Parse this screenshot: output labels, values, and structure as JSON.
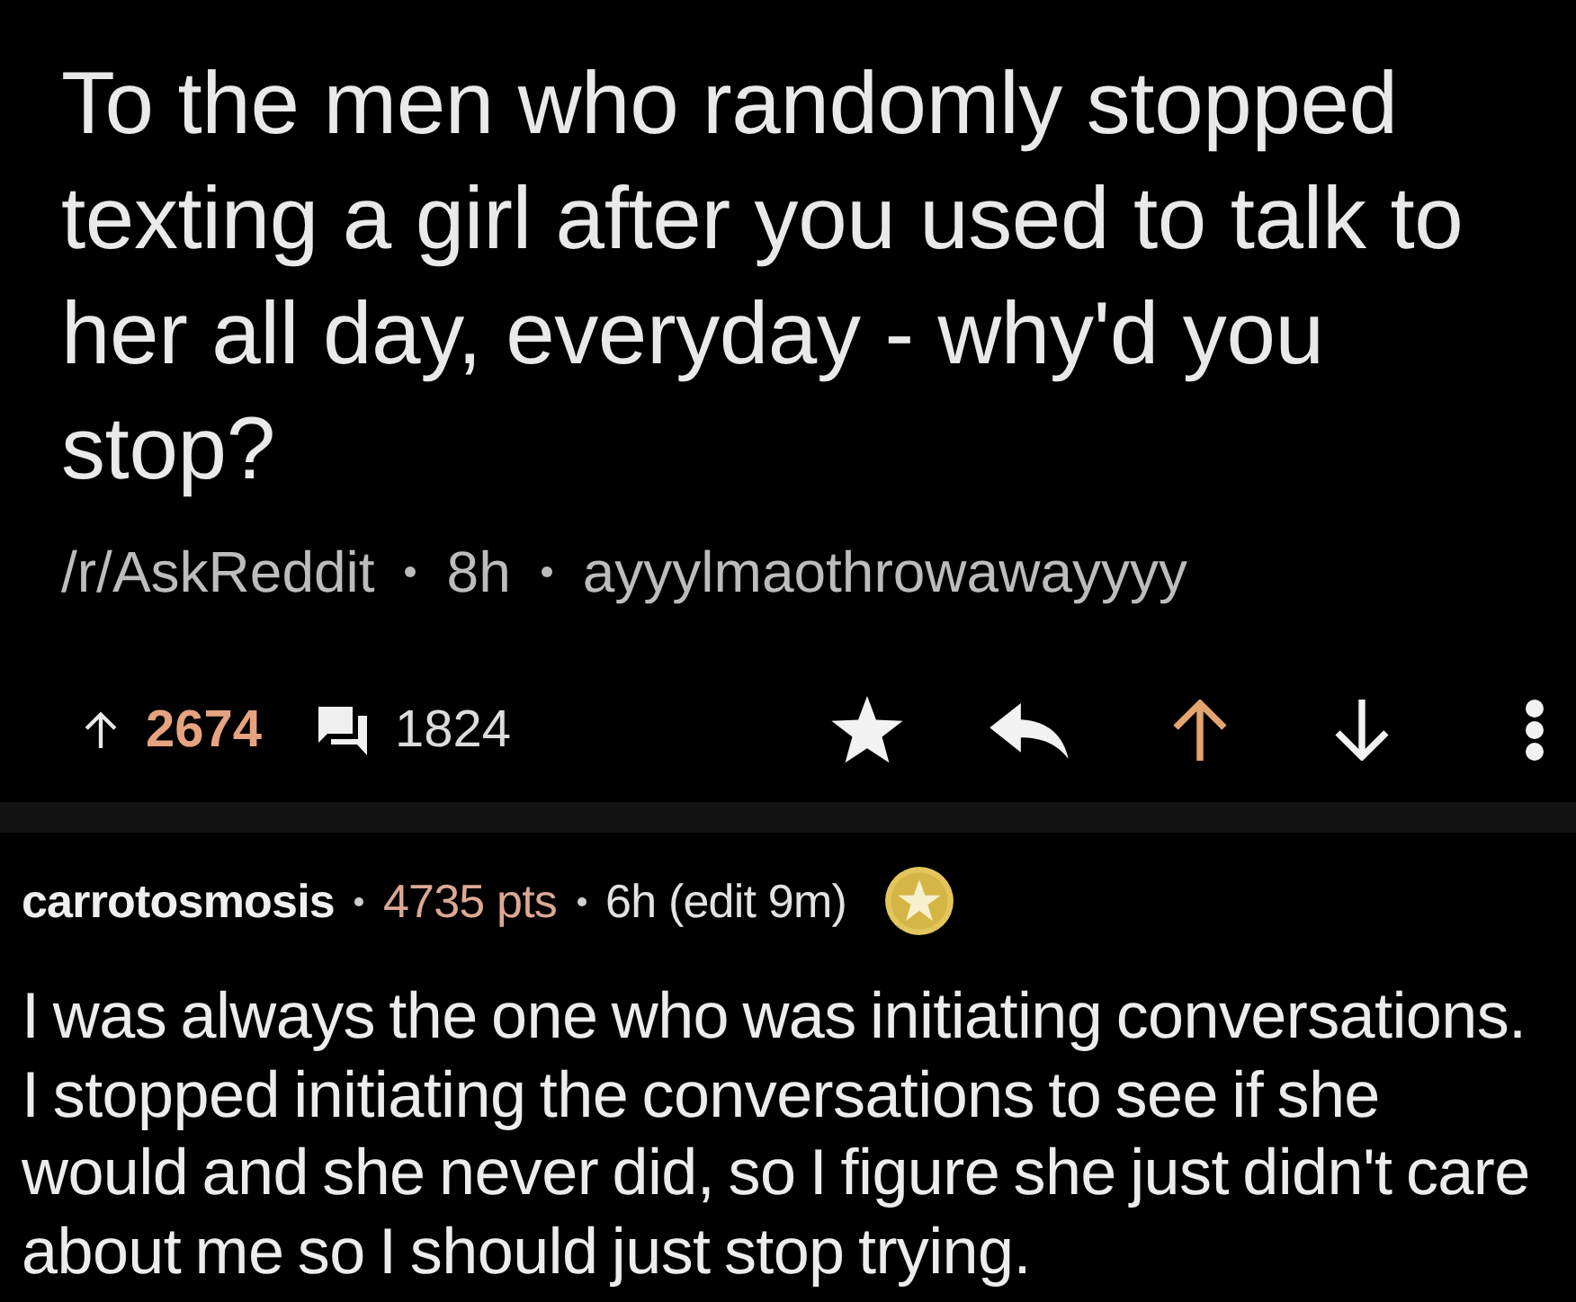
{
  "post": {
    "title": "To the men who randomly stopped texting a girl after you used to talk to her all day, everyday - why'd you stop?",
    "subreddit": "/r/AskReddit",
    "age": "8h",
    "author": "ayyylmaothrowawayyyy",
    "score": "2674",
    "comments": "1824",
    "upvoted": true,
    "downvoted": false
  },
  "comment": {
    "author": "carrotosmosis",
    "points": "4735 pts",
    "age": "6h (edit 9m)",
    "gilded": true,
    "body": "I was always the one who was initiating conversations. I stopped initiating the conversations to see if she would and she never did, so I figure she just didn't care about me so I should just stop trying."
  }
}
